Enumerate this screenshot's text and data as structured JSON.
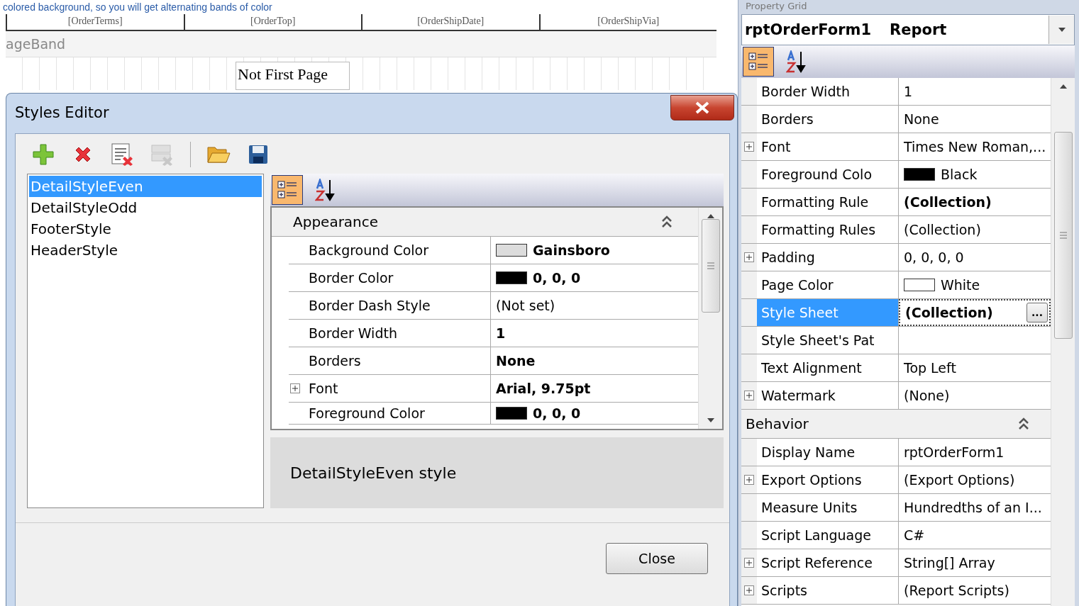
{
  "caption": "colored background, so you will get alternating bands of color",
  "band_headers": [
    "[OrderTerms]",
    "[OrderTop]",
    "[OrderShipDate]",
    "[OrderShipVia]"
  ],
  "band_label": "ageBand",
  "page_label": "Not First Page",
  "dialog": {
    "title": "Styles Editor",
    "toolbar": [
      {
        "kind": "add",
        "disabled": false
      },
      {
        "kind": "delete",
        "disabled": false
      },
      {
        "kind": "purge",
        "disabled": false
      },
      {
        "kind": "clear",
        "disabled": true
      },
      {
        "kind": "open",
        "disabled": false
      },
      {
        "kind": "save",
        "disabled": false
      }
    ],
    "styles": [
      {
        "label": "DetailStyleEven",
        "selected": true
      },
      {
        "label": "DetailStyleOdd",
        "selected": false
      },
      {
        "label": "FooterStyle",
        "selected": false
      },
      {
        "label": "HeaderStyle",
        "selected": false
      }
    ],
    "grid_modes": [
      {
        "kind": "categorized",
        "selected": true
      },
      {
        "kind": "alphabetical",
        "selected": false
      }
    ],
    "category": "Appearance",
    "rows": [
      {
        "name": "Background Color",
        "value": "Gainsboro",
        "bold": true,
        "color": "#dcdcdc",
        "expandable": false
      },
      {
        "name": "Border Color",
        "value": "0, 0, 0",
        "bold": true,
        "color": "#000000",
        "expandable": false
      },
      {
        "name": "Border Dash Style",
        "value": "(Not set)",
        "bold": false,
        "expandable": false
      },
      {
        "name": "Border Width",
        "value": "1",
        "bold": true,
        "expandable": false
      },
      {
        "name": "Borders",
        "value": "None",
        "bold": true,
        "expandable": false
      },
      {
        "name": "Font",
        "value": "Arial, 9.75pt",
        "bold": true,
        "expandable": true
      },
      {
        "name": "Foreground Color",
        "value": "0, 0, 0",
        "bold": true,
        "color": "#000000",
        "expandable": false
      }
    ],
    "description": "DetailStyleEven style",
    "close": "Close"
  },
  "property_grid": {
    "title": "Property Grid",
    "object": "rptOrderForm1",
    "type": "Report",
    "modes": [
      {
        "kind": "categorized",
        "selected": true
      },
      {
        "kind": "alphabetical",
        "selected": false
      }
    ],
    "items": [
      {
        "kind": "row",
        "name": "Border Width",
        "value": "1",
        "bold": false,
        "expandable": false,
        "selected": false
      },
      {
        "kind": "row",
        "name": "Borders",
        "value": "None",
        "bold": false,
        "expandable": false,
        "selected": false
      },
      {
        "kind": "row",
        "name": "Font",
        "value": "Times New Roman,...",
        "bold": false,
        "expandable": true,
        "selected": false
      },
      {
        "kind": "row",
        "name": "Foreground Colo",
        "value": "Black",
        "color": "#000000",
        "expandable": false,
        "selected": false
      },
      {
        "kind": "row",
        "name": "Formatting Rule",
        "value": "(Collection)",
        "bold": true,
        "expandable": false,
        "selected": false
      },
      {
        "kind": "row",
        "name": "Formatting Rules",
        "value": "(Collection)",
        "bold": false,
        "expandable": false,
        "selected": false
      },
      {
        "kind": "row",
        "name": "Padding",
        "value": "0, 0, 0, 0",
        "bold": false,
        "expandable": true,
        "selected": false
      },
      {
        "kind": "row",
        "name": "Page Color",
        "value": "White",
        "color": "#ffffff",
        "expandable": false,
        "selected": false
      },
      {
        "kind": "row",
        "name": "Style Sheet",
        "value": "(Collection)",
        "bold": true,
        "expandable": false,
        "selected": true,
        "button": "..."
      },
      {
        "kind": "row",
        "name": "Style Sheet's Pat",
        "expandable": false,
        "selected": false
      },
      {
        "kind": "row",
        "name": "Text Alignment",
        "value": "Top Left",
        "bold": false,
        "expandable": false,
        "selected": false
      },
      {
        "kind": "row",
        "name": "Watermark",
        "value": "(None)",
        "bold": false,
        "expandable": true,
        "selected": false
      },
      {
        "kind": "category",
        "name": "Behavior"
      },
      {
        "kind": "row",
        "name": "Display Name",
        "value": "rptOrderForm1",
        "bold": false,
        "expandable": false,
        "selected": false
      },
      {
        "kind": "row",
        "name": "Export Options",
        "value": "(Export Options)",
        "bold": false,
        "expandable": true,
        "selected": false
      },
      {
        "kind": "row",
        "name": "Measure Units",
        "value": "Hundredths of an I...",
        "bold": false,
        "expandable": false,
        "selected": false
      },
      {
        "kind": "row",
        "name": "Script Language",
        "value": "C#",
        "bold": false,
        "expandable": false,
        "selected": false
      },
      {
        "kind": "row",
        "name": "Script Reference",
        "value": "String[] Array",
        "bold": false,
        "expandable": true,
        "selected": false
      },
      {
        "kind": "row",
        "name": "Scripts",
        "value": "(Report Scripts)",
        "bold": false,
        "expandable": true,
        "selected": false
      }
    ]
  }
}
